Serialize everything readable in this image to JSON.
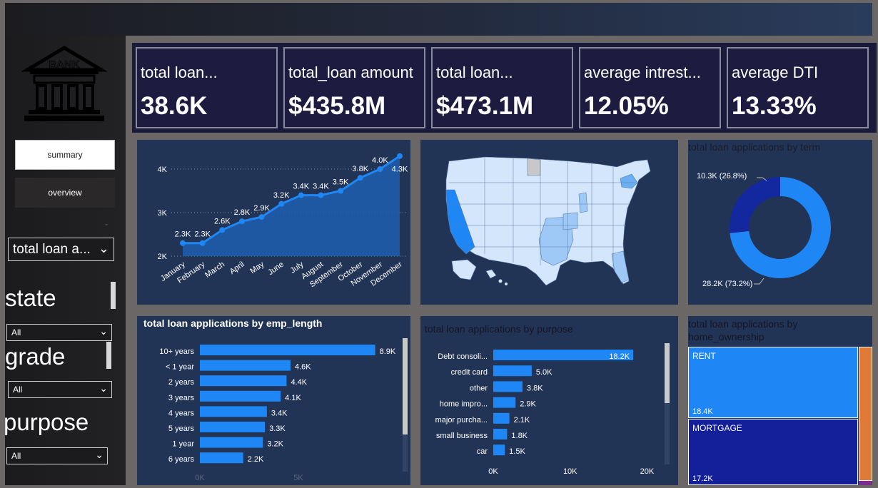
{
  "sidebar": {
    "logo_text": "BANK",
    "nav": {
      "summary_label": "summary",
      "overview_label": "overview"
    },
    "measure_select": {
      "value": "total loan a..."
    },
    "slicers": [
      {
        "title": "state",
        "value": "All"
      },
      {
        "title": "grade",
        "value": "All"
      },
      {
        "title": "purpose",
        "value": "All"
      }
    ]
  },
  "kpis": [
    {
      "label": "total loan...",
      "value": "38.6K"
    },
    {
      "label": "total_loan amount",
      "value": "$435.8M"
    },
    {
      "label": "total loan...",
      "value": "$473.1M"
    },
    {
      "label": "average intrest...",
      "value": "12.05%"
    },
    {
      "label": "average DTI",
      "value": "13.33%"
    }
  ],
  "colors": {
    "accent": "#1f87f5",
    "panel_bg": "#223455",
    "kpi_bg": "#1d1c40",
    "donut_dark": "#13279e",
    "treemap_rent": "#1f87f5",
    "treemap_mortgage": "#13209a",
    "treemap_other": "#e07a38"
  },
  "map": {
    "icon": "us-states-map"
  },
  "treemap": {
    "title": "total loan applications by home_ownership",
    "cells": [
      {
        "label": "RENT",
        "value": "18.4K"
      },
      {
        "label": "MORTGAGE",
        "value": "17.2K"
      }
    ]
  },
  "chart_data": [
    {
      "type": "area",
      "title": "",
      "categories": [
        "January",
        "February",
        "March",
        "April",
        "May",
        "June",
        "July",
        "August",
        "September",
        "October",
        "November",
        "December"
      ],
      "values": [
        2.3,
        2.3,
        2.6,
        2.8,
        2.9,
        3.2,
        3.4,
        3.4,
        3.5,
        3.8,
        4.0,
        4.3
      ],
      "data_labels": [
        "2.3K",
        "2.3K",
        "2.6K",
        "2.8K",
        "2.9K",
        "3.2K",
        "3.4K",
        "3.4K",
        "3.5K",
        "3.8K",
        "4.0K",
        "4.3K"
      ],
      "yticks": [
        "2K",
        "3K",
        "4K"
      ],
      "ylim": [
        2,
        4.3
      ],
      "grid": true
    },
    {
      "type": "pie",
      "title": "total loan applications by term",
      "values": [
        28.2,
        10.3
      ],
      "data_labels": [
        "28.2K (73.2%)",
        "10.3K (26.8%)"
      ],
      "colors": [
        "#1f87f5",
        "#13279e"
      ]
    },
    {
      "type": "bar",
      "title": "total loan applications by emp_length",
      "categories": [
        "10+ years",
        "< 1 year",
        "2 years",
        "3 years",
        "4 years",
        "5 years",
        "1 year",
        "6 years"
      ],
      "values": [
        8.9,
        4.6,
        4.4,
        4.1,
        3.4,
        3.3,
        3.2,
        2.2
      ],
      "data_labels": [
        "8.9K",
        "4.6K",
        "4.4K",
        "4.1K",
        "3.4K",
        "3.3K",
        "3.2K",
        "2.2K"
      ],
      "xticks": [
        "0K",
        "5K"
      ],
      "xlim": [
        0,
        10
      ]
    },
    {
      "type": "bar",
      "title": "total loan applications by purpose",
      "categories": [
        "Debt consoli...",
        "credit card",
        "other",
        "home impro...",
        "major purcha...",
        "small business",
        "car"
      ],
      "values": [
        18.2,
        5.0,
        3.8,
        2.9,
        2.1,
        1.8,
        1.5
      ],
      "data_labels": [
        "18.2K",
        "5.0K",
        "3.8K",
        "2.9K",
        "2.1K",
        "1.8K",
        "1.5K"
      ],
      "xticks": [
        "0K",
        "10K",
        "20K"
      ],
      "xlim": [
        0,
        22
      ]
    }
  ]
}
